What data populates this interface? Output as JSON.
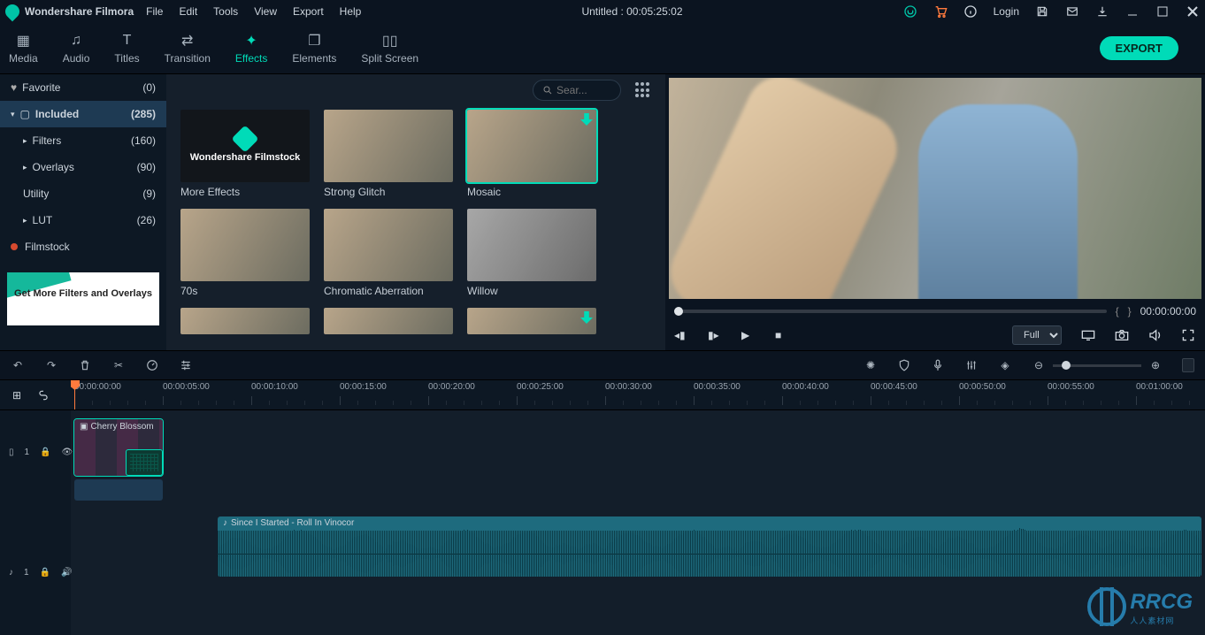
{
  "app": {
    "name": "Wondershare Filmora"
  },
  "menu": {
    "file": "File",
    "edit": "Edit",
    "tools": "Tools",
    "view": "View",
    "export": "Export",
    "help": "Help"
  },
  "title_center": "Untitled : 00:05:25:02",
  "login_label": "Login",
  "maintabs": {
    "media": "Media",
    "audio": "Audio",
    "titles": "Titles",
    "transition": "Transition",
    "effects": "Effects",
    "elements": "Elements",
    "split": "Split Screen"
  },
  "export_btn": "EXPORT",
  "search": {
    "placeholder": "Sear..."
  },
  "sidebar": {
    "favorite": {
      "label": "Favorite",
      "count": "(0)"
    },
    "included": {
      "label": "Included",
      "count": "(285)"
    },
    "filters": {
      "label": "Filters",
      "count": "(160)"
    },
    "overlays": {
      "label": "Overlays",
      "count": "(90)"
    },
    "utility": {
      "label": "Utility",
      "count": "(9)"
    },
    "lut": {
      "label": "LUT",
      "count": "(26)"
    },
    "filmstock": {
      "label": "Filmstock"
    },
    "promo": "Get More Filters and Overlays"
  },
  "cards": {
    "more": "More Effects",
    "more_brand": "Wondershare Filmstock",
    "strong": "Strong Glitch",
    "mosaic": "Mosaic",
    "seventies": "70s",
    "chroma": "Chromatic Aberration",
    "willow": "Willow"
  },
  "preview": {
    "brkt_l": "{",
    "brkt_r": "}",
    "time": "00:00:00:00",
    "quality": "Full"
  },
  "ruler": {
    "stamps": [
      "00:00:00:00",
      "00:00:05:00",
      "00:00:10:00",
      "00:00:15:00",
      "00:00:20:00",
      "00:00:25:00",
      "00:00:30:00",
      "00:00:35:00",
      "00:00:40:00",
      "00:00:45:00",
      "00:00:50:00",
      "00:00:55:00",
      "00:01:00:00"
    ]
  },
  "tracks": {
    "video_label": "1",
    "audio_label": "1",
    "video_clip": "Cherry Blossom",
    "audio_clip": "Since I Started - Roll In Vinocor"
  },
  "watermark": {
    "big": "RRCG",
    "small": "人人素材网"
  }
}
